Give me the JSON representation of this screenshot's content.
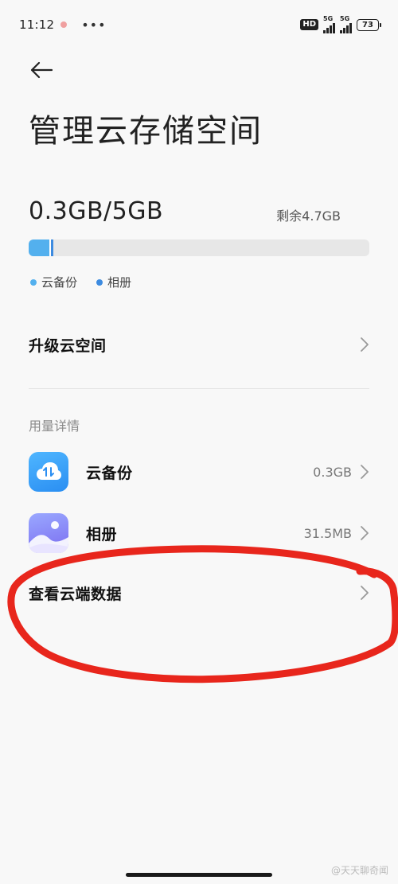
{
  "status_bar": {
    "time": "11:12",
    "more": "•••",
    "hd": "HD",
    "net1": "5G",
    "net2": "5G",
    "battery": "73"
  },
  "header": {
    "title": "管理云存储空间"
  },
  "storage": {
    "used_total": "0.3GB/5GB",
    "remaining": "剩余4.7GB",
    "progress": {
      "cloud_backup_fraction": 0.06,
      "album_fraction": 0.007
    },
    "colors": {
      "cloud_backup": "#53b0ee",
      "album": "#3d8be0"
    },
    "legend": [
      {
        "label": "云备份",
        "color": "#53b0ee"
      },
      {
        "label": "相册",
        "color": "#3d8be0"
      }
    ]
  },
  "upgrade": {
    "label": "升级云空间"
  },
  "usage_section": {
    "header": "用量详情",
    "items": [
      {
        "label": "云备份",
        "value": "0.3GB",
        "icon": "cloud-backup-icon"
      },
      {
        "label": "相册",
        "value": "31.5MB",
        "icon": "photo-album-icon"
      }
    ]
  },
  "view_cloud": {
    "label": "查看云端数据"
  },
  "annotation_color": "#e8261c",
  "watermark": "@天天聊奇闻"
}
